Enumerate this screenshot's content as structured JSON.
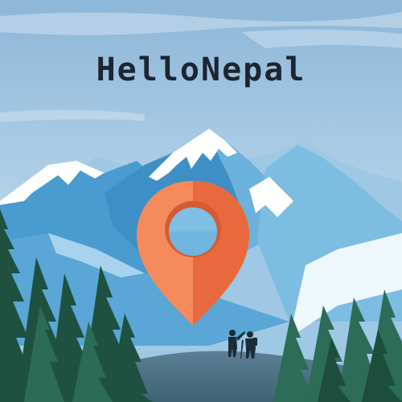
{
  "app": {
    "title": "HelloNepal"
  },
  "icons": {
    "location_pin": "map-pin-icon",
    "hikers": "hikers-illustration"
  },
  "colors": {
    "sky_top": "#8fb8d8",
    "sky_bottom": "#cfe3f0",
    "mountain_dark": "#3c8fc4",
    "mountain_mid": "#6ab3dc",
    "mountain_far": "#9bc9e6",
    "snow": "#ffffff",
    "pin_light": "#f58a5c",
    "pin_dark": "#e86a3c",
    "pine_dark": "#1e4d3b",
    "pine_mid": "#2f6a55",
    "title": "#1c2531"
  }
}
